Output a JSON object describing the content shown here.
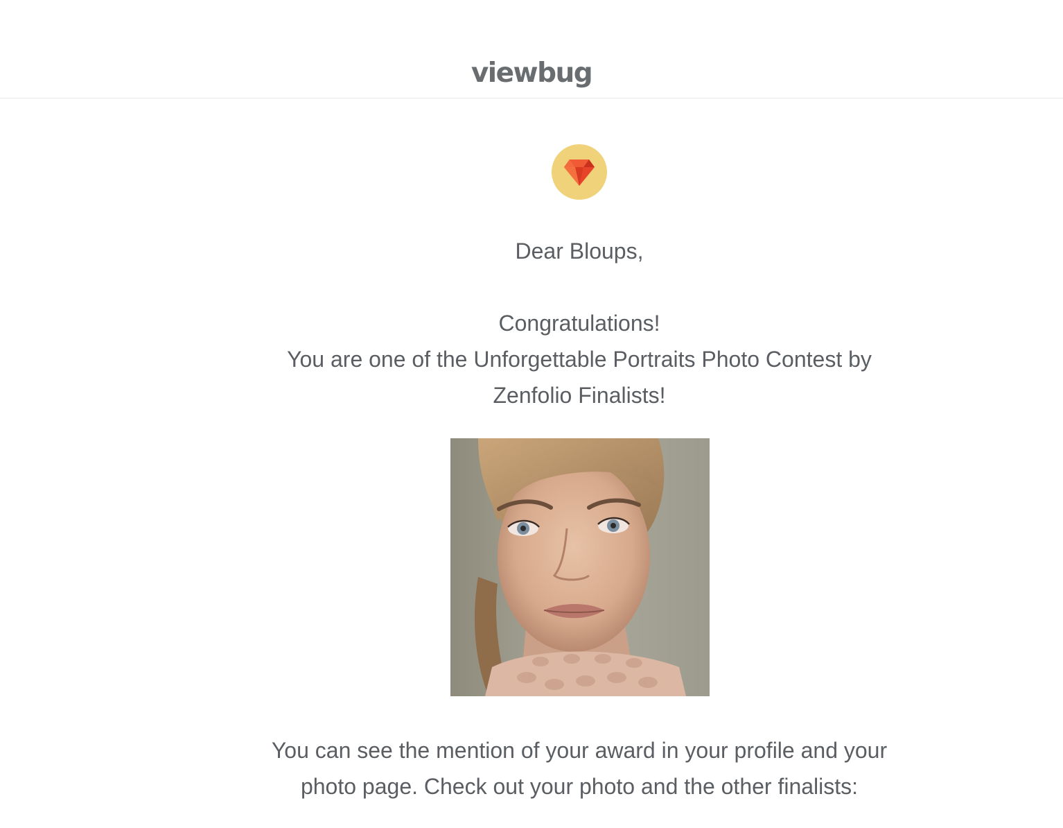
{
  "header": {
    "logo": "viewbug"
  },
  "badge": {
    "icon": "diamond-icon",
    "color": "#f0d27a",
    "gem_color": "#e8442a"
  },
  "email": {
    "greeting": "Dear Bloups,",
    "congrats": "Congratulations!",
    "message_line1": "You are one of the Unforgettable Portraits Photo Contest by",
    "message_line2": "Zenfolio Finalists!",
    "footer_line1": "You can see the mention of your award in your profile and your",
    "footer_line2": "photo page. Check out your photo and the other finalists:"
  },
  "photo": {
    "subject": "portrait-photo"
  }
}
